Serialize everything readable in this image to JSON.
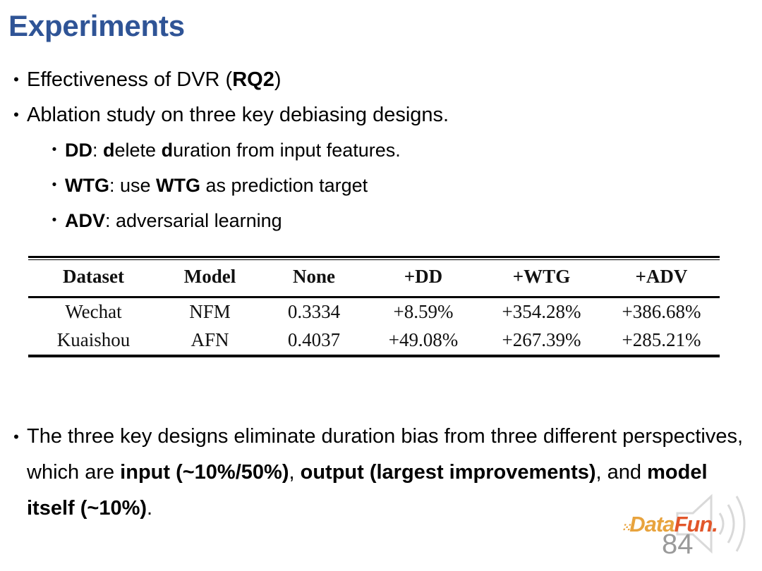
{
  "slide": {
    "title": "Experiments",
    "title_color": "#2F5496",
    "page_number": "84"
  },
  "bullets": [
    {
      "level": 1,
      "marker": "•",
      "segments": [
        {
          "text": "Effectiveness of DVR (",
          "bold": false
        },
        {
          "text": "RQ2",
          "bold": true
        },
        {
          "text": ")",
          "bold": false
        }
      ]
    },
    {
      "level": 1,
      "marker": "•",
      "segments": [
        {
          "text": "Ablation study on three key debiasing designs.",
          "bold": false
        }
      ]
    },
    {
      "level": 2,
      "marker": "•",
      "segments": [
        {
          "text": "DD",
          "bold": true
        },
        {
          "text": ": ",
          "bold": false
        },
        {
          "text": "d",
          "bold": true
        },
        {
          "text": "elete ",
          "bold": false
        },
        {
          "text": "d",
          "bold": true
        },
        {
          "text": "uration from input features.",
          "bold": false
        }
      ]
    },
    {
      "level": 2,
      "marker": "•",
      "segments": [
        {
          "text": "WTG",
          "bold": true
        },
        {
          "text": ": use ",
          "bold": false
        },
        {
          "text": "WTG",
          "bold": true
        },
        {
          "text": " as prediction target",
          "bold": false
        }
      ]
    },
    {
      "level": 2,
      "marker": "•",
      "segments": [
        {
          "text": "ADV",
          "bold": true
        },
        {
          "text": ": adversarial learning",
          "bold": false
        }
      ]
    }
  ],
  "table": {
    "headers": [
      "Dataset",
      "Model",
      "None",
      "+DD",
      "+WTG",
      "+ADV"
    ],
    "rows": [
      {
        "dataset": "Wechat",
        "model": "NFM",
        "none": "0.3334",
        "dd": "+8.59%",
        "wtg": "+354.28%",
        "adv": "+386.68%"
      },
      {
        "dataset": "Kuaishou",
        "model": "AFN",
        "none": "0.4037",
        "dd": "+49.08%",
        "wtg": "+267.39%",
        "adv": "+285.21%"
      }
    ]
  },
  "summary": {
    "marker": "•",
    "segments": [
      {
        "text": "The three key designs eliminate duration bias from three different perspectives, which are ",
        "bold": false
      },
      {
        "text": "input (~10%/50%)",
        "bold": true
      },
      {
        "text": ", ",
        "bold": false
      },
      {
        "text": "output (largest improvements)",
        "bold": true
      },
      {
        "text": ", and ",
        "bold": false
      },
      {
        "text": "model itself (~10%)",
        "bold": true
      },
      {
        "text": ".",
        "bold": false
      }
    ]
  },
  "watermark": {
    "dots": "⁙",
    "brand_part1": "Data",
    "brand_part2": "Fun.",
    "color_part1": "#E8A33D",
    "color_part2": "#E2562A"
  }
}
